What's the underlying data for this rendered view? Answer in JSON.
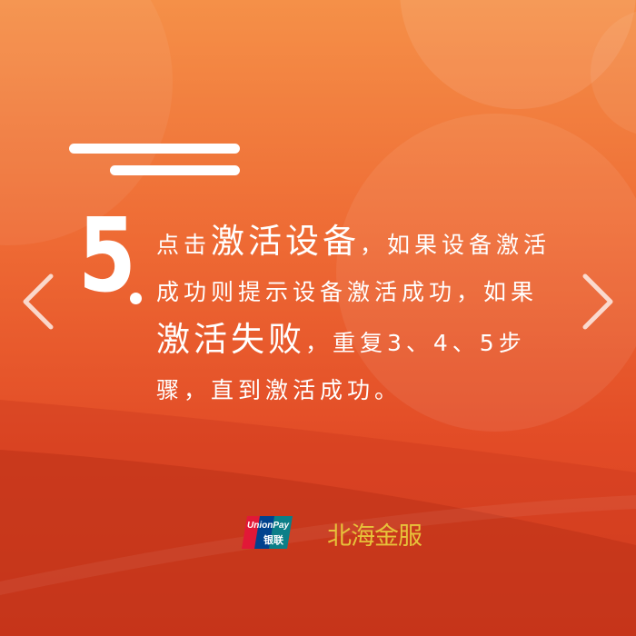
{
  "slide": {
    "step_number": "5",
    "text_segments": [
      {
        "text": "点击",
        "emphasis": false
      },
      {
        "text": "激活设备",
        "emphasis": true
      },
      {
        "text": "，如果设备激活成功则提示设备激活成功，如果",
        "emphasis": false
      },
      {
        "text": "激活失败",
        "emphasis": true
      },
      {
        "text": "，重复3、4、5步骤，直到激活成功。",
        "emphasis": false
      }
    ]
  },
  "navigation": {
    "prev_icon": "chevron-left-icon",
    "next_icon": "chevron-right-icon"
  },
  "footer": {
    "unionpay_logo_text": "UnionPay",
    "unionpay_logo_cn": "银联",
    "brand_logo_text": "北海金服"
  },
  "colors": {
    "background_top": "#f59048",
    "background_bottom": "#d63d20",
    "text": "#ffffff",
    "brand_gold": "#e7c23a",
    "unionpay_red": "#e21837",
    "unionpay_blue": "#01428e",
    "unionpay_teal": "#0b7f88"
  }
}
